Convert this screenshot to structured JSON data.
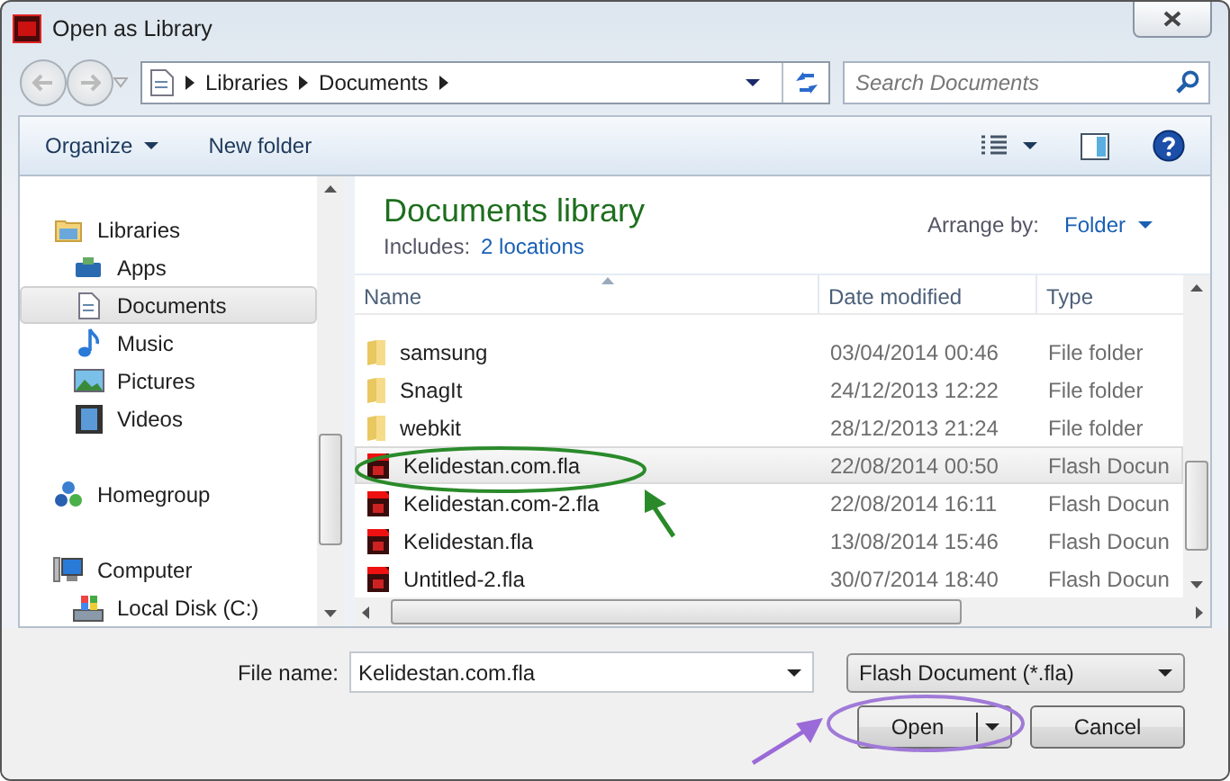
{
  "window": {
    "title": "Open as Library"
  },
  "address": {
    "breadcrumb": [
      "Libraries",
      "Documents"
    ]
  },
  "search": {
    "placeholder": "Search Documents"
  },
  "toolbar": {
    "organize": "Organize",
    "new_folder": "New folder"
  },
  "nav_pane": {
    "groups": [
      {
        "label": "Libraries",
        "kind": "library",
        "selected": false,
        "children": [
          {
            "label": "Apps",
            "kind": "apps",
            "selected": false
          },
          {
            "label": "Documents",
            "kind": "document",
            "selected": true
          },
          {
            "label": "Music",
            "kind": "music",
            "selected": false
          },
          {
            "label": "Pictures",
            "kind": "pictures",
            "selected": false
          },
          {
            "label": "Videos",
            "kind": "videos",
            "selected": false
          }
        ]
      },
      {
        "label": "Homegroup",
        "kind": "homegroup",
        "selected": false
      },
      {
        "label": "Computer",
        "kind": "computer",
        "selected": false,
        "children": [
          {
            "label": "Local Disk (C:)",
            "kind": "disk",
            "selected": false
          }
        ]
      }
    ]
  },
  "library": {
    "title": "Documents library",
    "includes_label": "Includes:",
    "includes_link": "2 locations",
    "arrange_label": "Arrange by:",
    "arrange_value": "Folder"
  },
  "file_list": {
    "columns": [
      "Name",
      "Date modified",
      "Type"
    ],
    "rows": [
      {
        "kind": "folder",
        "name": "samsung",
        "date": "03/04/2014 00:46",
        "type": "File folder",
        "selected": false
      },
      {
        "kind": "folder",
        "name": "SnagIt",
        "date": "24/12/2013 12:22",
        "type": "File folder",
        "selected": false
      },
      {
        "kind": "folder",
        "name": "webkit",
        "date": "28/12/2013 21:24",
        "type": "File folder",
        "selected": false
      },
      {
        "kind": "fla",
        "name": "Kelidestan.com.fla",
        "date": "22/08/2014 00:50",
        "type": "Flash Docun",
        "selected": true
      },
      {
        "kind": "fla",
        "name": "Kelidestan.com-2.fla",
        "date": "22/08/2014 16:11",
        "type": "Flash Docun",
        "selected": false
      },
      {
        "kind": "fla",
        "name": "Kelidestan.fla",
        "date": "13/08/2014 15:46",
        "type": "Flash Docun",
        "selected": false
      },
      {
        "kind": "fla",
        "name": "Untitled-2.fla",
        "date": "30/07/2014 18:40",
        "type": "Flash Docun",
        "selected": false
      }
    ]
  },
  "bottom": {
    "file_name_label": "File name:",
    "file_name": "Kelidestan.com.fla",
    "file_type": "Flash Document (*.fla)",
    "open": "Open",
    "cancel": "Cancel"
  }
}
